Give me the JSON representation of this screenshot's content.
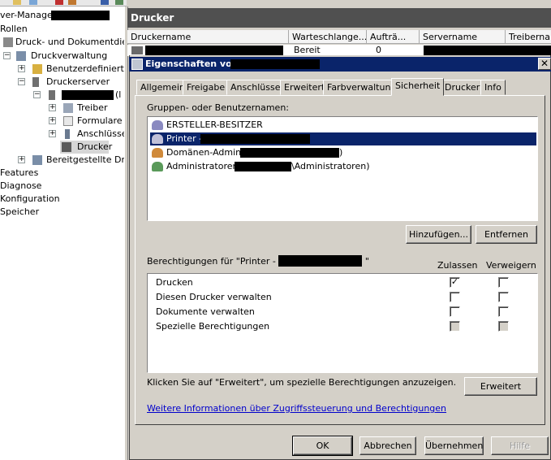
{
  "tree": {
    "root_label": "ver-Manager (",
    "items": [
      {
        "label": "Rollen"
      },
      {
        "label": "Druck- und Dokumentdienst"
      },
      {
        "label": "Druckverwaltung"
      },
      {
        "label": "Benutzerdefinierte"
      },
      {
        "label": "Druckerserver"
      },
      {
        "label": "(l"
      },
      {
        "label": "Treiber"
      },
      {
        "label": "Formulare"
      },
      {
        "label": "Anschlüsse"
      },
      {
        "label": "Drucker"
      },
      {
        "label": "Bereitgestellte Druc"
      },
      {
        "label": "Features"
      },
      {
        "label": "Diagnose"
      },
      {
        "label": "Konfiguration"
      },
      {
        "label": "Speicher"
      }
    ]
  },
  "pane": {
    "title": "Drucker",
    "columns": [
      "Druckername",
      "Warteschlange...",
      "Aufträ...",
      "Servername",
      "Treibernam"
    ],
    "row": {
      "queue": "Bereit",
      "jobs": "0"
    }
  },
  "dialog": {
    "title": "Eigenschaften von",
    "tabs": [
      "Allgemein",
      "Freigabe",
      "Anschlüsse",
      "Erweitert",
      "Farbverwaltung",
      "Sicherheit",
      "Drucker",
      "Info"
    ],
    "active_tab": "Sicherheit",
    "groups_label": "Gruppen- oder Benutzernamen:",
    "users": [
      {
        "name": "ERSTELLER-BESITZER",
        "selected": false
      },
      {
        "name": "Printer -",
        "selected": true
      },
      {
        "name": "Domänen-Admins (",
        "suffix": ")",
        "selected": false
      },
      {
        "name": "Administratoren (",
        "suffix": "\\Administratoren)",
        "selected": false
      }
    ],
    "add_button": "Hinzufügen...",
    "remove_button": "Entfernen",
    "permissions_label_prefix": "Berechtigungen für \"Printer -",
    "permissions_label_suffix": "\"",
    "allow_header": "Zulassen",
    "deny_header": "Verweigern",
    "permissions": [
      {
        "name": "Drucken",
        "allow": true,
        "deny": false,
        "disabled": false
      },
      {
        "name": "Diesen Drucker verwalten",
        "allow": false,
        "deny": false,
        "disabled": false
      },
      {
        "name": "Dokumente verwalten",
        "allow": false,
        "deny": false,
        "disabled": false
      },
      {
        "name": "Spezielle Berechtigungen",
        "allow": false,
        "deny": false,
        "disabled": true
      }
    ],
    "advanced_hint": "Klicken Sie auf \"Erweitert\", um spezielle Berechtigungen anzuzeigen.",
    "advanced_button": "Erweitert",
    "help_link": "Weitere Informationen über Zugriffssteuerung und Berechtigungen",
    "ok_button": "OK",
    "cancel_button": "Abbrechen",
    "apply_button": "Übernehmen",
    "help_button": "Hilfe",
    "close_glyph": "✕",
    "check_glyph": "✓"
  },
  "colors": {
    "selection": "#0a246a",
    "pane_title_bg": "#505050",
    "link": "#0000cc"
  }
}
